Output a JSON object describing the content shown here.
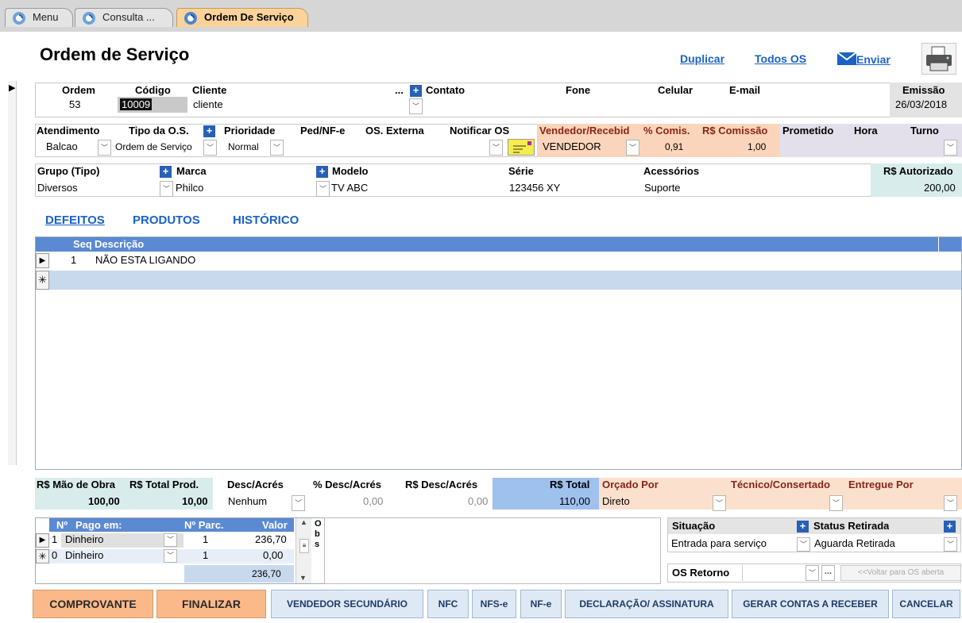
{
  "tabs": [
    {
      "label": "Menu"
    },
    {
      "label": "Consulta ..."
    },
    {
      "label": "Ordem De Serviço"
    }
  ],
  "title": "Ordem de Serviço",
  "links": {
    "duplicar": "Duplicar",
    "todos": "Todos OS",
    "enviar": "Enviar"
  },
  "row1": {
    "ordem_label": "Ordem",
    "ordem": "53",
    "codigo_label": "Código",
    "codigo": "10009",
    "cliente_label": "Cliente",
    "cliente": "cliente",
    "cliente_more": "...",
    "contato_label": "Contato",
    "fone_label": "Fone",
    "celular_label": "Celular",
    "email_label": "E-mail",
    "emissao_label": "Emissão",
    "emissao": "26/03/2018"
  },
  "row2": {
    "atendimento_label": "Atendimento",
    "atendimento": "Balcao",
    "tipo_label": "Tipo da O.S.",
    "tipo": "Ordem de Serviço",
    "prioridade_label": "Prioridade",
    "prioridade": "Normal",
    "ped_label": "Ped/NF-e",
    "osext_label": "OS. Externa",
    "notificar_label": "Notificar OS",
    "vendedor_label": "Vendedor/Recebid",
    "vendedor": "VENDEDOR",
    "comis_label": "% Comis.",
    "comis": "0,91",
    "rscomissao_label": "R$ Comissão",
    "rscomissao": "1,00",
    "prometido_label": "Prometido",
    "hora_label": "Hora",
    "turno_label": "Turno"
  },
  "row3": {
    "grupo_label": "Grupo (Tipo)",
    "grupo": "Diversos",
    "marca_label": "Marca",
    "marca": "Philco",
    "modelo_label": "Modelo",
    "modelo": "TV ABC",
    "serie_label": "Série",
    "serie": "123456 XY",
    "acessorios_label": "Acessórios",
    "acessorios": "Suporte",
    "autorizado_label": "R$ Autorizado",
    "autorizado": "200,00"
  },
  "subtabs": [
    "DEFEITOS",
    "PRODUTOS",
    "HISTÓRICO"
  ],
  "defeitos": {
    "seq_label": "Seq",
    "desc_label": "Descrição",
    "rows": [
      {
        "seq": "1",
        "desc": "NÃO ESTA LIGANDO"
      }
    ]
  },
  "totals": {
    "mao_label": "R$ Mão de Obra",
    "mao": "100,00",
    "prod_label": "R$ Total Prod.",
    "prod": "10,00",
    "desc_label": "Desc/Acrés",
    "desc": "Nenhum",
    "pdesc_label": "% Desc/Acrés",
    "pdesc": "0,00",
    "rsdesc_label": "R$ Desc/Acrés",
    "rsdesc": "0,00",
    "total_label": "R$ Total",
    "total": "110,00",
    "orcado_label": "Orçado Por",
    "orcado": "Direto",
    "tecnico_label": "Técnico/Consertado",
    "entregue_label": "Entregue Por"
  },
  "pagamentos": {
    "n_label": "Nº",
    "pago_label": "Pago em:",
    "parc_label": "Nº Parc.",
    "valor_label": "Valor",
    "rows": [
      {
        "n": "1",
        "pago": "Dinheiro",
        "parc": "1",
        "valor": "236,70"
      },
      {
        "n": "0",
        "pago": "Dinheiro",
        "parc": "1",
        "valor": "0,00"
      }
    ],
    "total": "236,70",
    "obs_label": [
      "O",
      "b",
      "s"
    ]
  },
  "situacao": {
    "label": "Situação",
    "value": "Entrada para serviço",
    "retirada_label": "Status Retirada",
    "retirada": "Aguarda Retirada",
    "retorno_label": "OS Retorno",
    "retorno_more": "...",
    "voltar": "<<Voltar para OS aberta"
  },
  "buttons": [
    "COMPROVANTE",
    "FINALIZAR",
    "VENDEDOR SECUNDÁRIO",
    "NFC",
    "NFS-e",
    "NF-e",
    "DECLARAÇÃO/ ASSINATURA",
    "GERAR CONTAS A RECEBER",
    "CANCELAR"
  ],
  "colors": {
    "accent": "#1a62c4",
    "grid_header": "#5b8ad2",
    "orange_tab": "#fbd39a",
    "salmon": "#fbd5bb",
    "teal": "#d8ecec",
    "lavender": "#e3e0eb"
  }
}
